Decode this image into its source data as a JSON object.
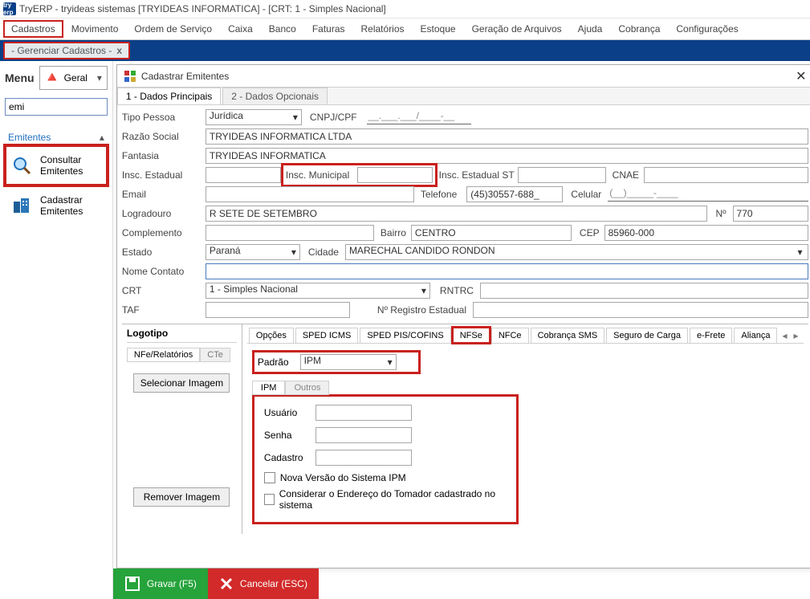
{
  "app": {
    "title": "TryERP - tryideas sistemas     [TRYIDEAS INFORMATICA] - [CRT: 1 - Simples Nacional]",
    "logo_text": "try erp"
  },
  "menubar": [
    "Cadastros",
    "Movimento",
    "Ordem de Serviço",
    "Caixa",
    "Banco",
    "Faturas",
    "Relatórios",
    "Estoque",
    "Geração de Arquivos",
    "Ajuda",
    "Cobrança",
    "Configurações"
  ],
  "doc_tab": {
    "label": "- Gerenciar Cadastros   -",
    "close": "x"
  },
  "sidebar": {
    "menu_label": "Menu",
    "menu_combo": "Geral",
    "search_value": "emi",
    "section": "Emitentes",
    "items": [
      {
        "label": "Consultar Emitentes",
        "hl": true
      },
      {
        "label": "Cadastrar Emitentes",
        "hl": false
      }
    ]
  },
  "window": {
    "title": "Cadastrar Emitentes",
    "tabs": {
      "t1": "1 - Dados Principais",
      "t2": "2 - Dados Opcionais"
    },
    "labels": {
      "tipo_pessoa": "Tipo Pessoa",
      "cnpj_cpf": "CNPJ/CPF",
      "razao_social": "Razão Social",
      "fantasia": "Fantasia",
      "insc_est": "Insc. Estadual",
      "insc_mun": "Insc. Municipal",
      "insc_st": "Insc. Estadual ST",
      "cnae": "CNAE",
      "email": "Email",
      "telefone": "Telefone",
      "celular": "Celular",
      "logradouro": "Logradouro",
      "numero": "Nº",
      "complemento": "Complemento",
      "bairro": "Bairro",
      "cep": "CEP",
      "estado": "Estado",
      "cidade": "Cidade",
      "nome_contato": "Nome Contato",
      "crt": "CRT",
      "rntrc": "RNTRC",
      "taf": "TAF",
      "reg_est": "Nº Registro Estadual"
    },
    "values": {
      "tipo_pessoa": "Jurídica",
      "cnpj_cpf": "__.___.___/____-__",
      "razao_social": "TRYIDEAS INFORMATICA LTDA",
      "fantasia": "TRYIDEAS INFORMATICA",
      "insc_est": "",
      "insc_mun": "",
      "insc_st": "",
      "cnae": "",
      "email": "",
      "telefone": "(45)30557-688_",
      "celular": "(__)_____-____",
      "logradouro": "R SETE DE SETEMBRO",
      "numero": "770",
      "complemento": "",
      "bairro": "CENTRO",
      "cep": "85960-000",
      "estado": "Paraná",
      "cidade": "MARECHAL CANDIDO RONDON",
      "nome_contato": "",
      "crt": "1 - Simples Nacional",
      "rntrc": "",
      "taf": "",
      "reg_est": ""
    }
  },
  "logo_pane": {
    "head": "Logotipo",
    "tabs": {
      "a": "NFe/Relatórios",
      "b": "CTe"
    },
    "select_btn": "Selecionar Imagem",
    "remove_btn": "Remover Imagem"
  },
  "options": {
    "tabs": [
      "Opções",
      "SPED ICMS",
      "SPED PIS/COFINS",
      "NFSe",
      "NFCe",
      "Cobrança SMS",
      "Seguro de Carga",
      "e-Frete",
      "Aliança"
    ],
    "active_index": 3,
    "padrao_label": "Padrão",
    "padrao_value": "IPM",
    "sub_tabs": {
      "a": "IPM",
      "b": "Outros"
    },
    "ipm": {
      "usuario_label": "Usuário",
      "senha_label": "Senha",
      "cadastro_label": "Cadastro",
      "chk1": "Nova Versão do Sistema IPM",
      "chk2": "Considerar o Endereço do Tomador cadastrado no sistema"
    }
  },
  "footer": {
    "save": "Gravar (F5)",
    "cancel": "Cancelar (ESC)"
  }
}
